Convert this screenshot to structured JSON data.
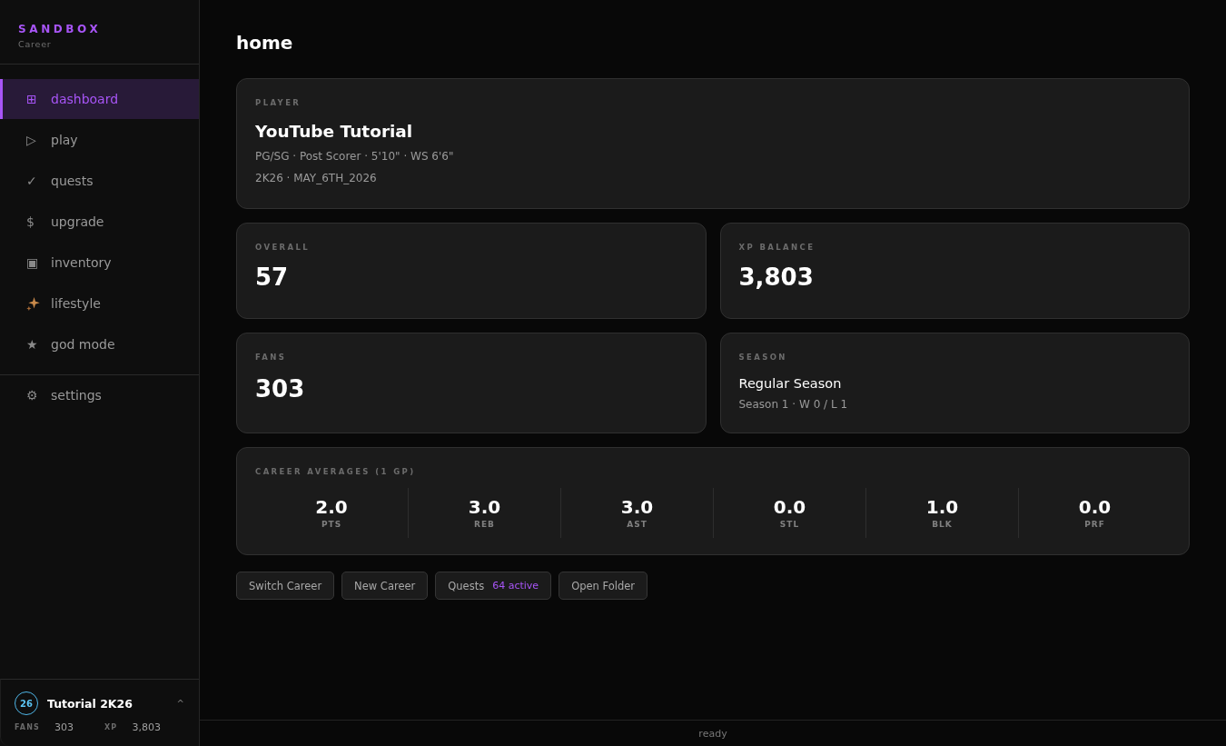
{
  "sidebar": {
    "brand": "SANDBOX",
    "subtitle": "Career",
    "items": [
      {
        "kind": "glyph",
        "icon": "⊞",
        "label": "dashboard",
        "selected": true
      },
      {
        "kind": "glyph",
        "icon": "▷",
        "label": "play",
        "selected": false
      },
      {
        "kind": "glyph",
        "icon": "✓",
        "label": "quests",
        "selected": false
      },
      {
        "kind": "glyph",
        "icon": "$",
        "label": "upgrade",
        "selected": false
      },
      {
        "kind": "glyph",
        "icon": "▣",
        "label": "inventory",
        "selected": false
      },
      {
        "kind": "sparkles",
        "label": "lifestyle",
        "selected": false
      },
      {
        "kind": "glyph",
        "icon": "★",
        "label": "god mode",
        "selected": false
      }
    ],
    "footer_items": [
      {
        "kind": "glyph",
        "icon": "⚙",
        "label": "settings",
        "selected": false
      }
    ],
    "profile": {
      "badge": "26",
      "name": "Tutorial 2K26",
      "caret": "^",
      "stats": [
        {
          "label": "FANS",
          "value": "303"
        },
        {
          "label": "XP",
          "value": "3,803"
        }
      ]
    }
  },
  "page": {
    "title": "home"
  },
  "player_card": {
    "label": "PLAYER",
    "name": "YouTube Tutorial",
    "lines": [
      "PG/SG · Post Scorer · 5'10\" · WS 6'6\"",
      "2K26 · MAY_6TH_2026"
    ]
  },
  "stat_cards": [
    {
      "kind": "number",
      "label": "OVERALL",
      "value": "57"
    },
    {
      "kind": "number",
      "label": "XP BALANCE",
      "value": "3,803"
    },
    {
      "kind": "number",
      "label": "FANS",
      "value": "303"
    },
    {
      "kind": "text",
      "label": "SEASON",
      "title": "Regular Season",
      "detail": "Season 1 · W 0 / L 1"
    }
  ],
  "career_averages": {
    "label": "CAREER AVERAGES (1 GP)",
    "stats": [
      {
        "value": "2.0",
        "label": "PTS"
      },
      {
        "value": "3.0",
        "label": "REB"
      },
      {
        "value": "3.0",
        "label": "AST"
      },
      {
        "value": "0.0",
        "label": "STL"
      },
      {
        "value": "1.0",
        "label": "BLK"
      },
      {
        "value": "0.0",
        "label": "PRF"
      }
    ]
  },
  "actions": [
    {
      "label": "Switch Career"
    },
    {
      "label": "New Career"
    },
    {
      "label": "Quests",
      "badge": "64 active"
    },
    {
      "label": "Open Folder"
    }
  ],
  "status_bar": {
    "text": "ready"
  }
}
